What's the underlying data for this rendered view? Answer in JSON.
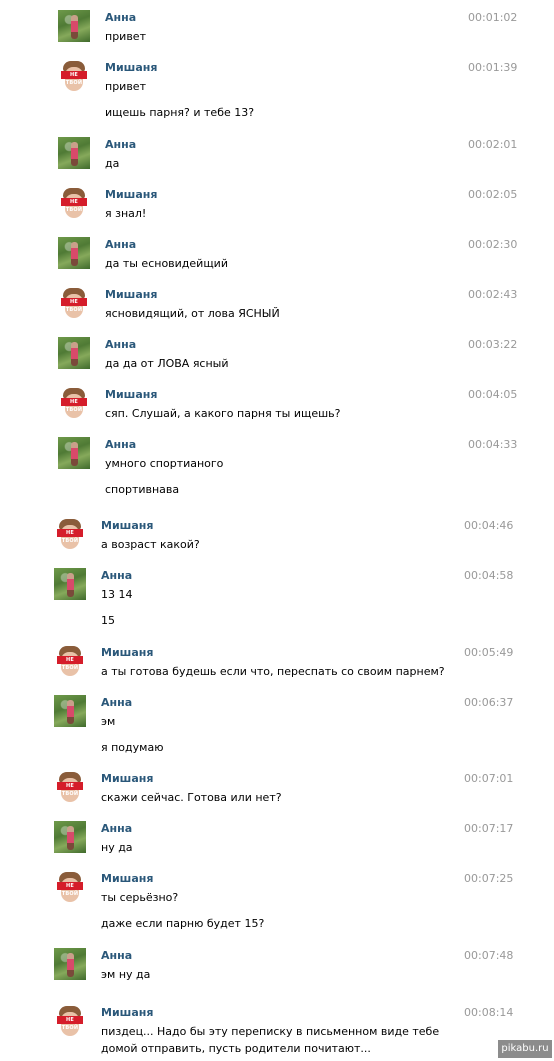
{
  "chat": {
    "users": {
      "anna": "Анна",
      "misha": "Мишаня"
    },
    "avatar_label": "НЕ ТВОЙ",
    "messages": [
      {
        "user": "Анна",
        "time": "00:01:02",
        "lines": [
          "привет"
        ]
      },
      {
        "user": "Мишаня",
        "time": "00:01:39",
        "lines": [
          "привет",
          "ищешь парня? и тебе 13?"
        ]
      },
      {
        "user": "Анна",
        "time": "00:02:01",
        "lines": [
          "да"
        ]
      },
      {
        "user": "Мишаня",
        "time": "00:02:05",
        "lines": [
          "я знал!"
        ]
      },
      {
        "user": "Анна",
        "time": "00:02:30",
        "lines": [
          "да ты есновидейщий"
        ]
      },
      {
        "user": "Мишаня",
        "time": "00:02:43",
        "lines": [
          "ясновидящий, от лова ЯСНЫЙ"
        ]
      },
      {
        "user": "Анна",
        "time": "00:03:22",
        "lines": [
          "да да от ЛОВА ясный"
        ]
      },
      {
        "user": "Мишаня",
        "time": "00:04:05",
        "lines": [
          "сяп. Слушай, а какого парня ты ищешь?"
        ]
      },
      {
        "user": "Анна",
        "time": "00:04:33",
        "lines": [
          "умного спортианого",
          "спортивнава"
        ]
      },
      {
        "user": "Мишаня",
        "time": "00:04:46",
        "lines": [
          "а возраст какой?"
        ]
      },
      {
        "user": "Анна",
        "time": "00:04:58",
        "lines": [
          "13 14",
          "15"
        ]
      },
      {
        "user": "Мишаня",
        "time": "00:05:49",
        "lines": [
          "а ты готова будешь если что, переспать со своим парнем?"
        ]
      },
      {
        "user": "Анна",
        "time": "00:06:37",
        "lines": [
          "эм",
          "я подумаю"
        ]
      },
      {
        "user": "Мишаня",
        "time": "00:07:01",
        "lines": [
          "скажи сейчас. Готова или нет?"
        ]
      },
      {
        "user": "Анна",
        "time": "00:07:17",
        "lines": [
          "ну да"
        ]
      },
      {
        "user": "Мишаня",
        "time": "00:07:25",
        "lines": [
          "ты серьёзно?",
          "даже если парню будет 15?"
        ]
      },
      {
        "user": "Анна",
        "time": "00:07:48",
        "lines": [
          "эм ну да"
        ]
      },
      {
        "user": "Мишаня",
        "time": "00:08:14",
        "lines": [
          "пиздец... Надо бы эту переписку в письменном виде тебе домой отправить, пусть родители почитают..."
        ]
      }
    ]
  },
  "watermark": "pikabu.ru"
}
